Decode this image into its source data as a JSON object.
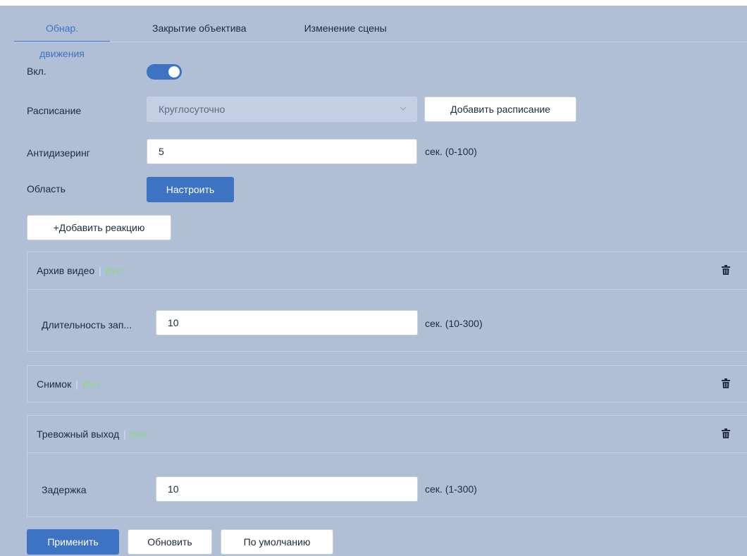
{
  "tabs": [
    {
      "label": "Обнар. движения",
      "active": true
    },
    {
      "label": "Закрытие объектива",
      "active": false
    },
    {
      "label": "Изменение сцены",
      "active": false
    }
  ],
  "form": {
    "enable_label": "Вкл.",
    "enable_on": true,
    "schedule_label": "Расписание",
    "schedule_value": "Круглосуточно",
    "add_schedule_button": "Добавить расписание",
    "antidither_label": "Антидизеринг",
    "antidither_value": "5",
    "antidither_unit": "сек. (0-100)",
    "area_label": "Область",
    "configure_button": "Настроить",
    "add_reaction_button": "+Добавить реакцию"
  },
  "reactions": {
    "video_archive": {
      "title": "Архив видео",
      "status": "Вкл.",
      "duration_label": "Длительность зап...",
      "duration_value": "10",
      "duration_unit": "сек. (10-300)"
    },
    "snapshot": {
      "title": "Снимок",
      "status": "Вкл."
    },
    "alarm_output": {
      "title": "Тревожный выход",
      "status": "Вкл.",
      "delay_label": "Задержка",
      "delay_value": "10",
      "delay_unit": "сек. (1-300)"
    }
  },
  "footer": {
    "apply_button": "Применить",
    "refresh_button": "Обновить",
    "default_button": "По умолчанию"
  },
  "colors": {
    "background": "#b0bfd6",
    "accent": "#3d73c2",
    "status_on": "#8fd48c"
  }
}
